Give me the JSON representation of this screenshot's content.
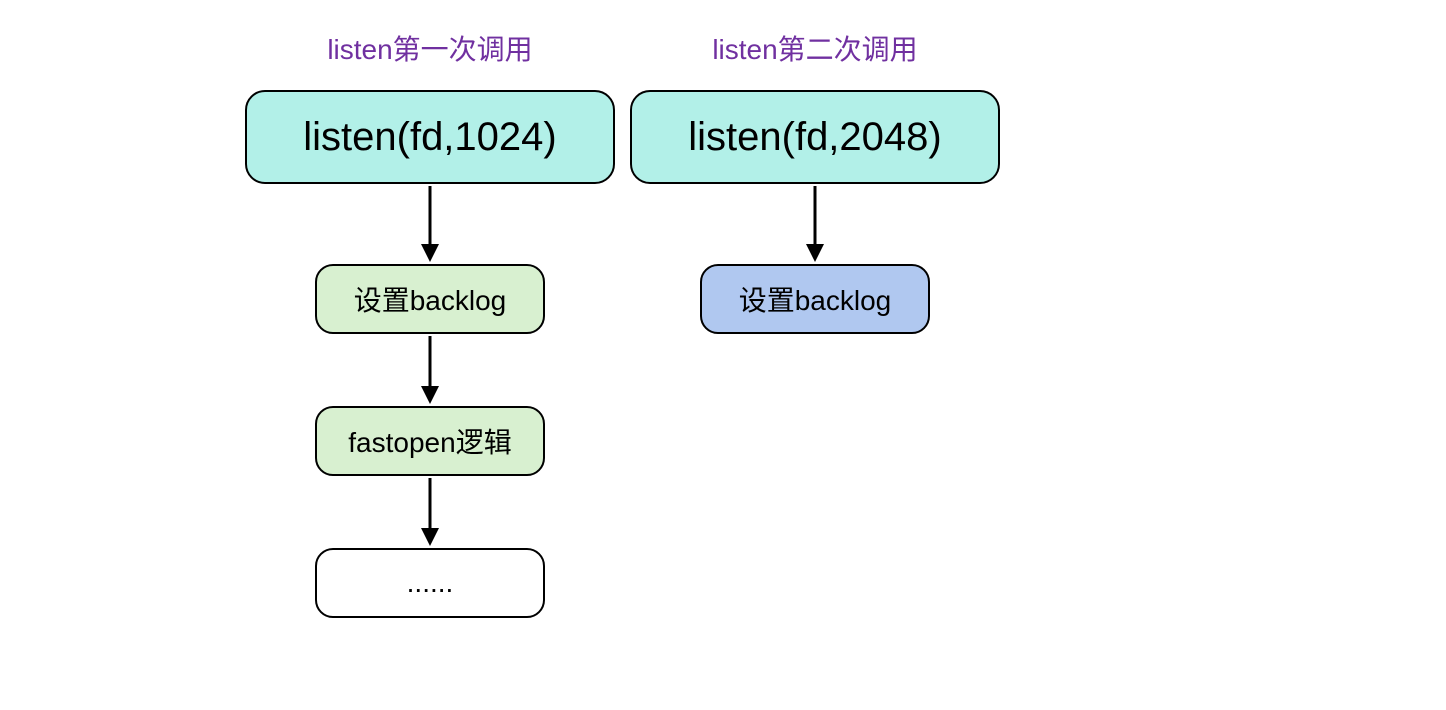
{
  "left": {
    "title": "listen第一次调用",
    "listen_box": "listen(fd,1024)",
    "steps": [
      {
        "label": "设置backlog",
        "style": "green"
      },
      {
        "label": "fastopen逻辑",
        "style": "green"
      },
      {
        "label": "......",
        "style": "white"
      }
    ]
  },
  "right": {
    "title": "listen第二次调用",
    "listen_box": "listen(fd,2048)",
    "steps": [
      {
        "label": "设置backlog",
        "style": "blue"
      }
    ]
  }
}
